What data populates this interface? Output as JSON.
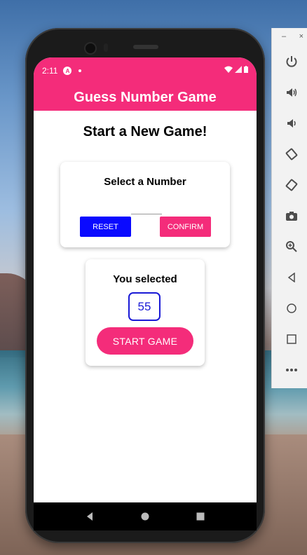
{
  "status_bar": {
    "time": "2:11",
    "app_badge": "A"
  },
  "app_bar": {
    "title": "Guess Number Game"
  },
  "screen": {
    "title": "Start a New Game!",
    "select_card": {
      "label": "Select a Number",
      "input_value": "",
      "reset_label": "RESET",
      "confirm_label": "CONFIRM"
    },
    "selected_card": {
      "label": "You selected",
      "number": "55",
      "start_label": "START GAME"
    }
  },
  "navigation": {
    "back_icon": "◀",
    "home_icon": "●",
    "recents_icon": "■"
  },
  "emulator_panel": {
    "minimize": "–",
    "close": "×",
    "icons": [
      "power-icon",
      "volume-up-icon",
      "volume-down-icon",
      "rotate-left-icon",
      "rotate-right-icon",
      "camera-icon",
      "zoom-icon",
      "back-icon",
      "home-icon",
      "overview-icon",
      "more-icon"
    ]
  },
  "colors": {
    "accent": "#f42c7a",
    "reset_button": "#0a0aff",
    "selected_number": "#1a1ad6"
  }
}
